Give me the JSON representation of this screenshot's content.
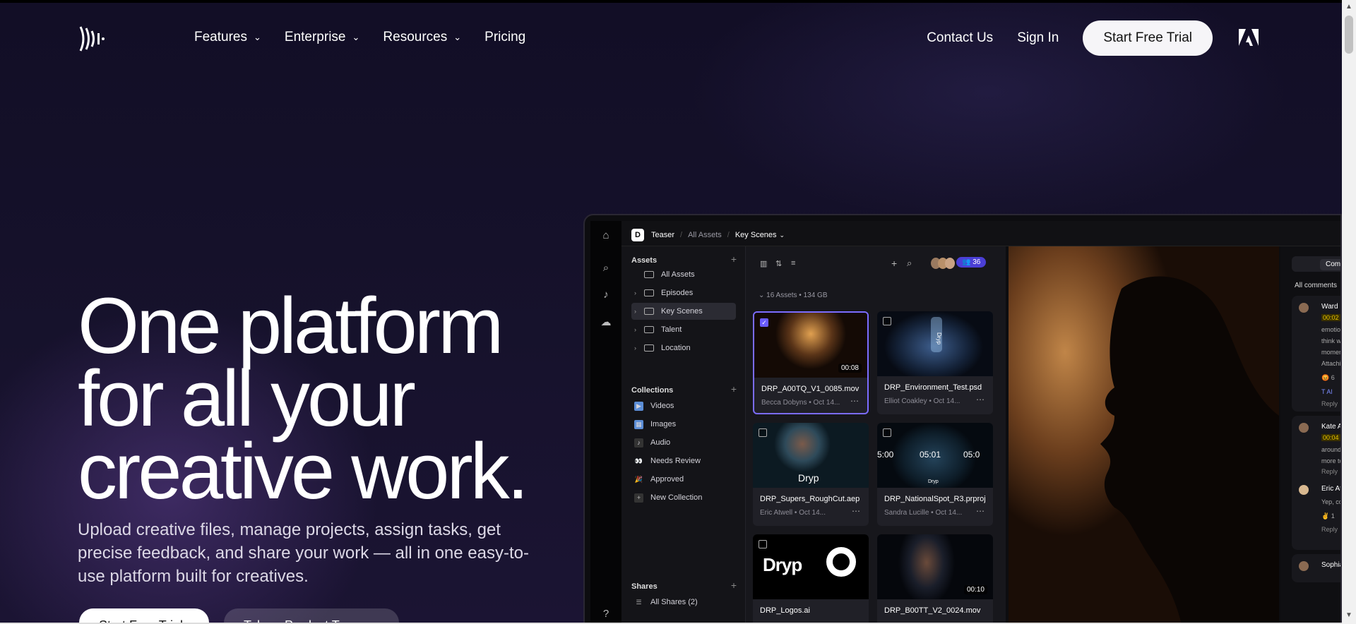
{
  "nav": {
    "items": [
      {
        "label": "Features",
        "dropdown": true
      },
      {
        "label": "Enterprise",
        "dropdown": true
      },
      {
        "label": "Resources",
        "dropdown": true
      },
      {
        "label": "Pricing",
        "dropdown": false
      }
    ],
    "contact": "Contact Us",
    "signin": "Sign In",
    "trial": "Start Free Trial"
  },
  "hero": {
    "line1": "One platform",
    "line2": "for all your",
    "line3": "creative work.",
    "subtitle": "Upload creative files, manage projects, assign tasks, get precise feedback, and share your work — all in one easy-to-use platform built for creatives.",
    "cta_primary": "Start Free Trial",
    "cta_secondary": "Take a Product Tour"
  },
  "app": {
    "breadcrumb": {
      "project": "Teaser",
      "level1": "All Assets",
      "level2": "Key Scenes",
      "logo_letter": "D"
    },
    "assets_header": "Assets",
    "assets": [
      {
        "label": "All Assets",
        "expand": false,
        "selected": false
      },
      {
        "label": "Episodes",
        "expand": true,
        "selected": false
      },
      {
        "label": "Key Scenes",
        "expand": true,
        "selected": true
      },
      {
        "label": "Talent",
        "expand": true,
        "selected": false
      },
      {
        "label": "Location",
        "expand": true,
        "selected": false
      }
    ],
    "collections_header": "Collections",
    "collections": [
      {
        "label": "Videos",
        "icon": "▶",
        "color": "#5b8dd6"
      },
      {
        "label": "Images",
        "icon": "▦",
        "color": "#5b8dd6"
      },
      {
        "label": "Audio",
        "icon": "♪",
        "color": "#555"
      },
      {
        "label": "Needs Review",
        "icon": "👀",
        "color": "#333"
      },
      {
        "label": "Approved",
        "icon": "🎉",
        "color": "#333"
      },
      {
        "label": "New Collection",
        "icon": "+",
        "color": "#333"
      }
    ],
    "shares_header": "Shares",
    "shares_item": "All Shares (2)",
    "member_count": "36",
    "asset_count": "16 Assets",
    "asset_size": "134 GB",
    "files": [
      {
        "name": "DRP_A00TQ_V1_0085.mov",
        "author": "Becca Dobyns",
        "date": "Oct 14...",
        "duration": "00:08",
        "selected": true,
        "thumb": "radial-gradient(ellipse 50px 50px at 80px 30px,#e0a050,#5a3418 60%,#140a05)"
      },
      {
        "name": "DRP_Environment_Test.psd",
        "author": "Elliot Coakley",
        "date": "Oct 14...",
        "duration": "",
        "selected": false,
        "thumb": "radial-gradient(ellipse 70px 50px at 80px 50px,#3d5d8c,#142238 70%,#070b14)"
      },
      {
        "name": "DRP_Supers_RoughCut.aep",
        "author": "Eric Atwell",
        "date": "Oct 14...",
        "duration": "",
        "selected": false,
        "thumb": "radial-gradient(ellipse 40px 40px at 70px 30px,#7a5a4a,#2e4a5a 60%,#0c1a22)"
      },
      {
        "name": "DRP_NationalSpot_R3.prproj",
        "author": "Sandra Lucille",
        "date": "Oct 14...",
        "duration": "",
        "selected": false,
        "thumb": "radial-gradient(ellipse 60px 50px at 80px 50px,#24435a,#0e1e2a 70%,#050a10)"
      },
      {
        "name": "DRP_Logos.ai",
        "author": "",
        "date": "",
        "duration": "",
        "selected": false,
        "thumb": "linear-gradient(#000,#000)"
      },
      {
        "name": "DRP_B00TT_V2_0024.mov",
        "author": "",
        "date": "",
        "duration": "00:10",
        "selected": false,
        "thumb": "radial-gradient(ellipse 40px 60px at 70px 40px,#6a4a3a,#1a1e2a 60%,#05070c)"
      }
    ],
    "timecodes": [
      "5:00",
      "05:01",
      "05:0"
    ],
    "thumb_texts": {
      "logo_word": "Dryp",
      "bottle_word": "Dryp",
      "swim_word": "Dryp",
      "runner_word": "Dryp"
    },
    "comments": {
      "tab": "Comme",
      "title": "All comments",
      "threads": [
        {
          "name": "Ward E",
          "time": "00:02",
          "text": [
            "emotio",
            "think w",
            "momen",
            "Attachi"
          ],
          "reaction": "😡 6",
          "reply": "Reply"
        },
        {
          "name": "Kate A",
          "time": "00:04",
          "text": [
            "around",
            "more to"
          ],
          "reply": "Reply"
        },
        {
          "name": "Eric Atv",
          "text": [
            "Yep, co"
          ],
          "reaction": "✌ 1",
          "reply": "Reply"
        },
        {
          "name": "Sophia"
        }
      ],
      "attach_label": "T Al"
    }
  }
}
